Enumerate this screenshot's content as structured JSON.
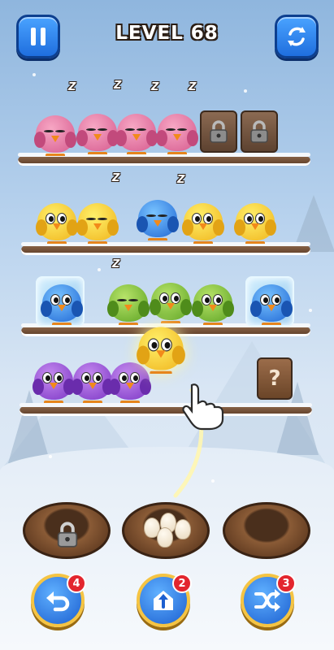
{
  "header": {
    "level_label": "LEVEL 68",
    "pause_icon": "pause-icon",
    "restart_icon": "restart-icon"
  },
  "board": {
    "branches": [
      {
        "slots": [
          {
            "type": "bird",
            "color": "pink",
            "state": "sleeping"
          },
          {
            "type": "bird",
            "color": "pink",
            "state": "sleeping"
          },
          {
            "type": "bird",
            "color": "pink",
            "state": "sleeping"
          },
          {
            "type": "bird",
            "color": "pink",
            "state": "sleeping"
          },
          {
            "type": "locked-slot",
            "icon": "padlock-icon"
          },
          {
            "type": "locked-slot",
            "icon": "padlock-icon"
          }
        ]
      },
      {
        "slots": [
          {
            "type": "bird",
            "color": "yellow"
          },
          {
            "type": "bird",
            "color": "yellow",
            "state": "sleeping"
          },
          {
            "type": "bird",
            "color": "blue",
            "state": "sleeping"
          },
          {
            "type": "bird",
            "color": "yellow"
          },
          {
            "type": "bird",
            "color": "yellow"
          }
        ]
      },
      {
        "slots": [
          {
            "type": "bird",
            "color": "blue",
            "state": "frozen"
          },
          {
            "type": "bird",
            "color": "green",
            "state": "sleeping"
          },
          {
            "type": "bird",
            "color": "green"
          },
          {
            "type": "bird",
            "color": "green"
          },
          {
            "type": "bird",
            "color": "blue",
            "state": "frozen"
          }
        ]
      },
      {
        "slots": [
          {
            "type": "bird",
            "color": "purple"
          },
          {
            "type": "bird",
            "color": "purple"
          },
          {
            "type": "bird",
            "color": "purple"
          },
          {
            "type": "mystery-box",
            "label": "?"
          }
        ]
      }
    ],
    "held_bird": {
      "color": "yellow",
      "state": "selected"
    },
    "sleep_text": "Z"
  },
  "nests": [
    {
      "state": "locked",
      "icon": "padlock-icon"
    },
    {
      "state": "eggs",
      "egg_count": 4
    },
    {
      "state": "empty"
    }
  ],
  "powerups": [
    {
      "name": "undo",
      "icon": "undo-icon",
      "count": "4"
    },
    {
      "name": "add-branch",
      "icon": "add-branch-icon",
      "count": "2"
    },
    {
      "name": "shuffle",
      "icon": "shuffle-icon",
      "count": "3"
    }
  ],
  "colors": {
    "button_blue": "#1f6ede",
    "badge_red": "#e3262e",
    "button_ring_gold": "#f5c443",
    "pink": "#d65a8e",
    "yellow": "#f0b41c",
    "blue": "#1f66d4",
    "green": "#5da323",
    "purple": "#7a35c4"
  }
}
